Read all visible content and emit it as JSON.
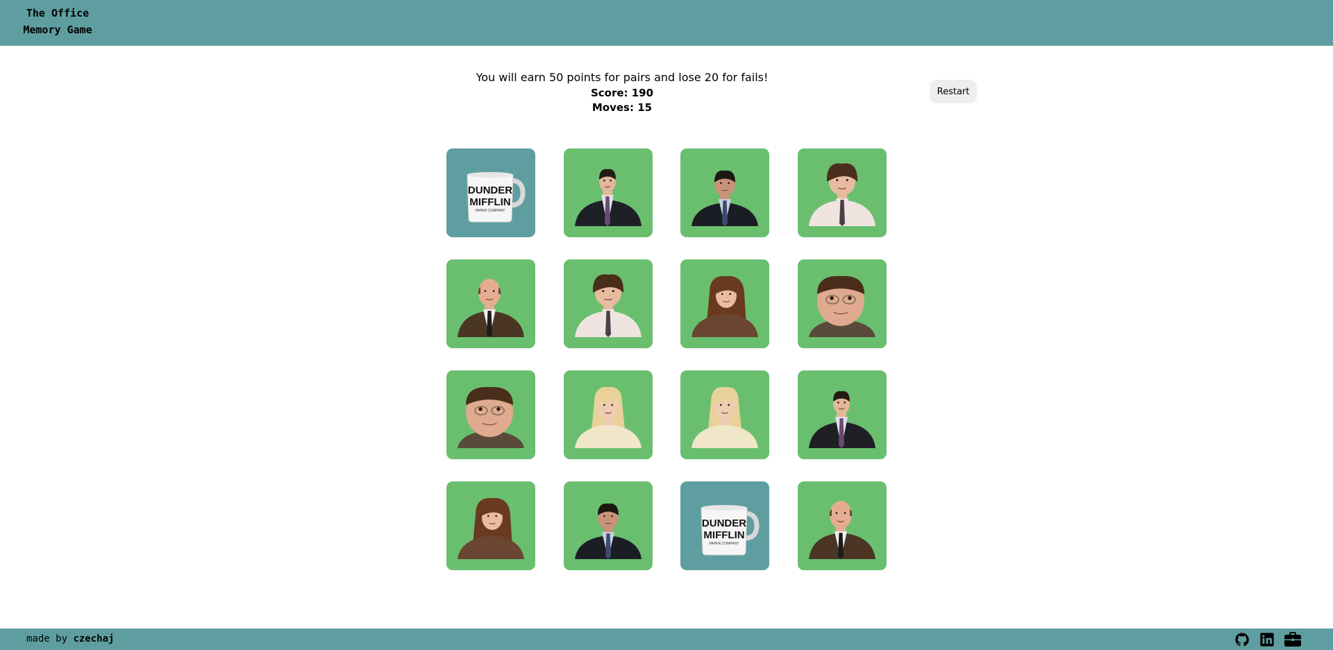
{
  "header": {
    "title_line1": "The Office",
    "title_line2": "Memory Game"
  },
  "game": {
    "rules": "You will earn 50 points for pairs and lose 20 for fails!",
    "score_label": "Score:",
    "score": "190",
    "moves_label": "Moves:",
    "moves": "15",
    "restart_label": "Restart"
  },
  "board": {
    "cards": [
      {
        "face": "mug",
        "state": "face-down"
      },
      {
        "face": "ryan",
        "state": "revealed"
      },
      {
        "face": "michael",
        "state": "revealed"
      },
      {
        "face": "jim",
        "state": "revealed"
      },
      {
        "face": "kevin",
        "state": "revealed"
      },
      {
        "face": "jim",
        "state": "revealed"
      },
      {
        "face": "pam",
        "state": "revealed"
      },
      {
        "face": "dwight",
        "state": "revealed"
      },
      {
        "face": "dwight",
        "state": "revealed"
      },
      {
        "face": "angela",
        "state": "revealed"
      },
      {
        "face": "angela",
        "state": "revealed"
      },
      {
        "face": "ryan",
        "state": "revealed"
      },
      {
        "face": "pam",
        "state": "revealed"
      },
      {
        "face": "michael",
        "state": "revealed"
      },
      {
        "face": "mug",
        "state": "face-down"
      },
      {
        "face": "kevin",
        "state": "revealed"
      }
    ]
  },
  "mug": {
    "line1": "DUNDER",
    "line2": "MIFFLIN",
    "line3": "PAPER COMPANY"
  },
  "footer": {
    "made_by": "made by",
    "author": "czechaj",
    "icons": [
      "github-icon",
      "linkedin-icon",
      "briefcase-icon"
    ]
  },
  "colors": {
    "header_bg": "#5f9ea0",
    "card_revealed_bg": "#6abf6f",
    "card_back_bg": "#5f9ea0",
    "restart_bg": "#eeeeee"
  }
}
